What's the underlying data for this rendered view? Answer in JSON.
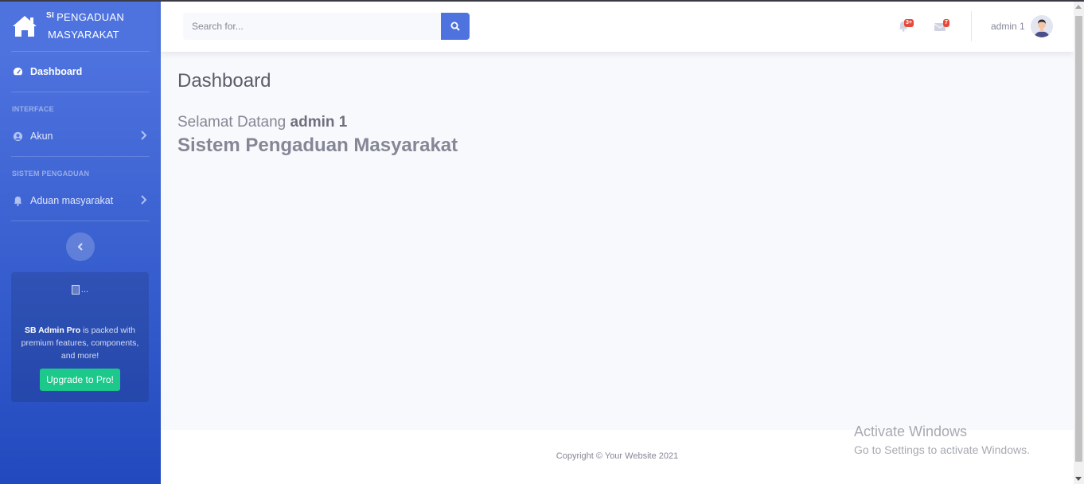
{
  "brand": {
    "sup": "SI",
    "line1": "PENGADUAN",
    "line2": "MASYARAKAT",
    "icon": "home-icon"
  },
  "sidebar": {
    "dashboard": {
      "label": "Dashboard",
      "icon": "tachometer-icon"
    },
    "heading_interface": "INTERFACE",
    "akun": {
      "label": "Akun",
      "icon": "user-circle-icon"
    },
    "heading_sistem": "SISTEM PENGADUAN",
    "aduan": {
      "label": "Aduan masyarakat",
      "icon": "bell-icon"
    },
    "card": {
      "img_alt": "...",
      "strong": "SB Admin Pro",
      "text": " is packed with premium features, components, and more!",
      "button": "Upgrade to Pro!"
    }
  },
  "topbar": {
    "search_placeholder": "Search for...",
    "alerts_badge": "3+",
    "messages_badge": "7",
    "user_name": "admin 1"
  },
  "main": {
    "title": "Dashboard",
    "welcome_prefix": "Selamat Datang ",
    "welcome_user": "admin 1",
    "app_name": "Sistem Pengaduan Masyarakat"
  },
  "footer": {
    "copyright": "Copyright © Your Website 2021"
  },
  "watermark": {
    "line1": "Activate Windows",
    "line2": "Go to Settings to activate Windows."
  },
  "colors": {
    "primary": "#4e73df",
    "primary_dark": "#224abe",
    "success": "#1cc88a",
    "danger": "#e74a3b",
    "text": "#858796"
  }
}
